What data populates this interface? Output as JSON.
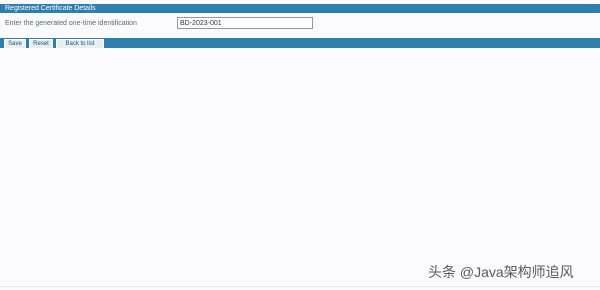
{
  "header": {
    "title": "Registered Certificate Details"
  },
  "form": {
    "field_label": "Enter the generated one-time identification",
    "field_value": "BD-2023-001"
  },
  "toolbar": {
    "buttons": [
      {
        "label": "Save"
      },
      {
        "label": "Reset"
      },
      {
        "label": "Back to list"
      }
    ]
  },
  "watermark": {
    "text": "头条 @Java架构师追风"
  },
  "colors": {
    "bar": "#2f7fae",
    "background": "#fbfbfd"
  }
}
